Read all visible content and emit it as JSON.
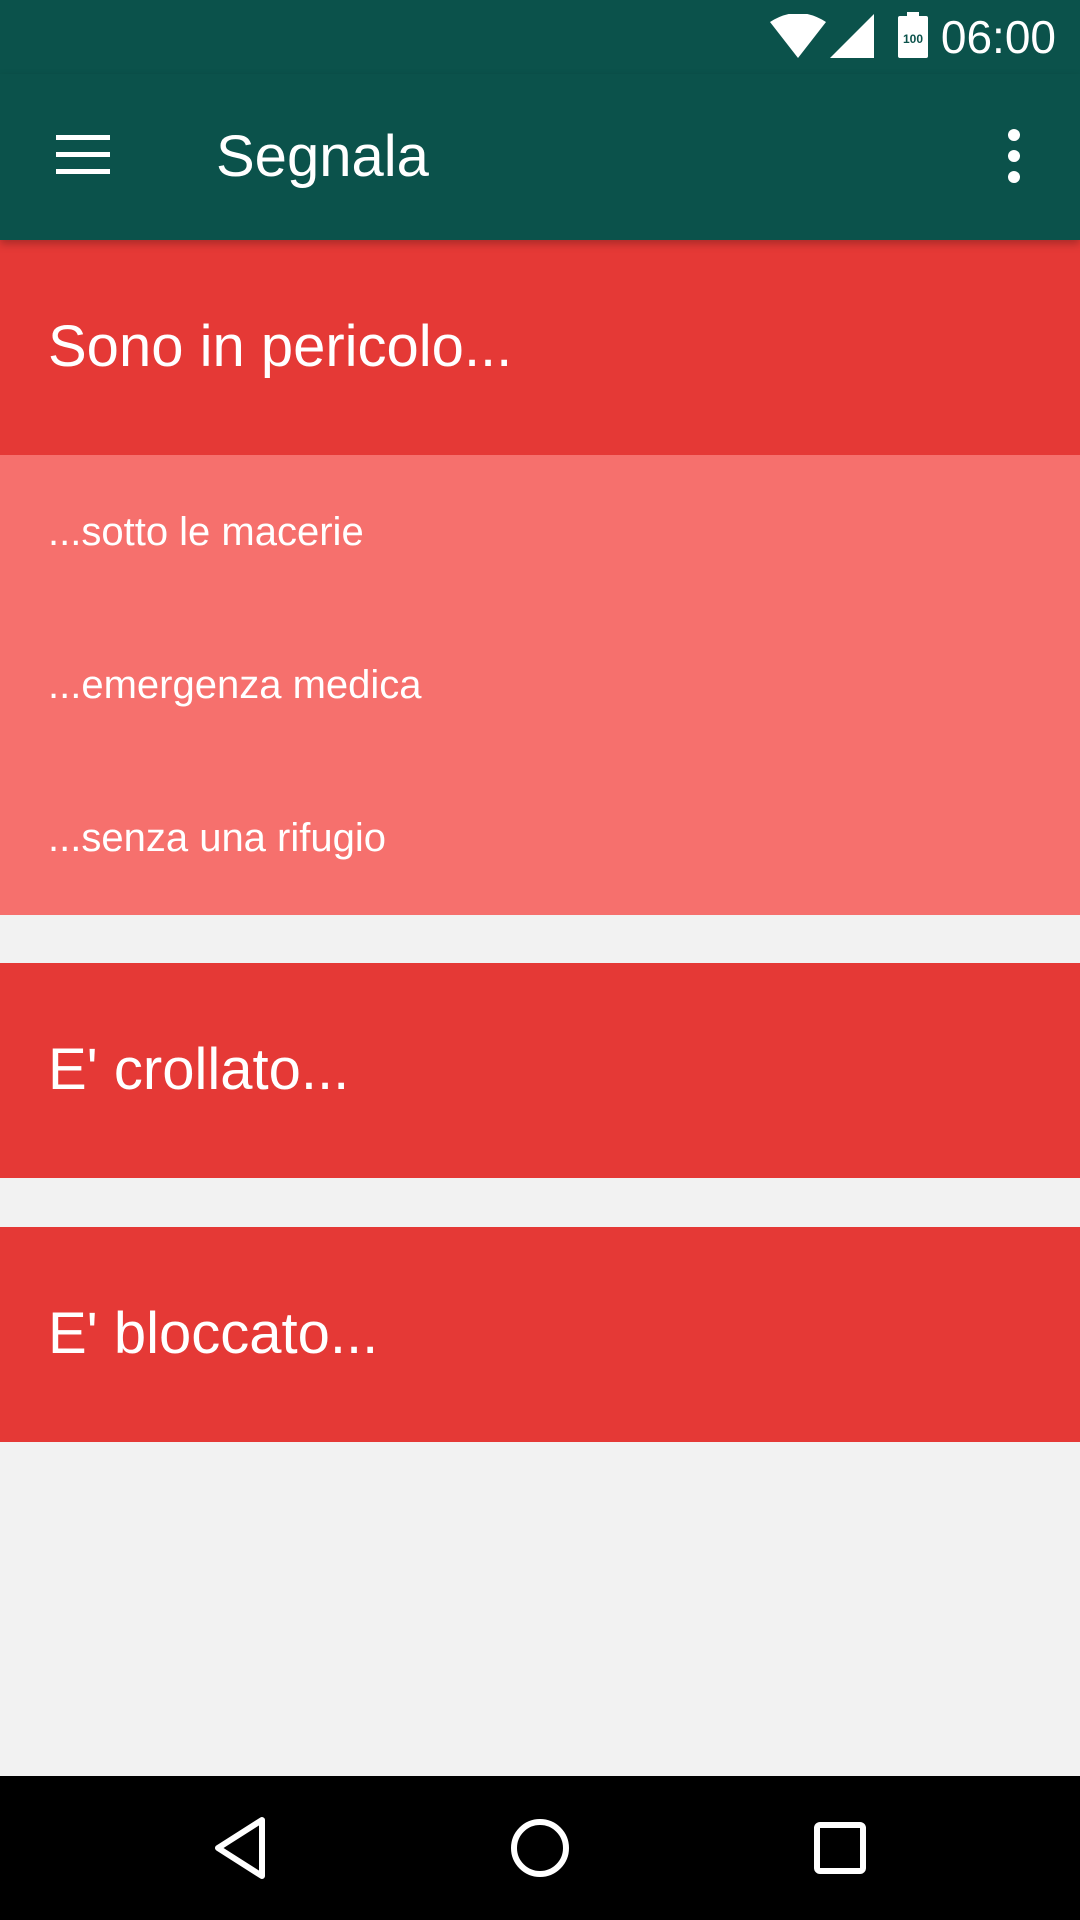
{
  "status_bar": {
    "time": "06:00",
    "battery_level": "100",
    "icons": [
      "wifi-icon",
      "cell-signal-icon",
      "battery-icon"
    ]
  },
  "app_bar": {
    "title": "Segnala",
    "menu_icon": "hamburger-menu-icon",
    "overflow_icon": "more-vert-icon"
  },
  "sections": [
    {
      "label": "Sono in pericolo...",
      "expanded": true,
      "items": [
        {
          "label": "...sotto le macerie"
        },
        {
          "label": "...emergenza medica"
        },
        {
          "label": "...senza una rifugio"
        }
      ]
    },
    {
      "label": "E' crollato...",
      "expanded": false
    },
    {
      "label": "E' bloccato...",
      "expanded": false
    }
  ],
  "nav_bar": {
    "icons": [
      "back-triangle-icon",
      "home-circle-icon",
      "recents-square-icon"
    ]
  },
  "colors": {
    "primary_dark": "#0b524b",
    "header_red": "#e53936",
    "sub_item_red": "#f6706d",
    "background": "#f2f2f2"
  }
}
